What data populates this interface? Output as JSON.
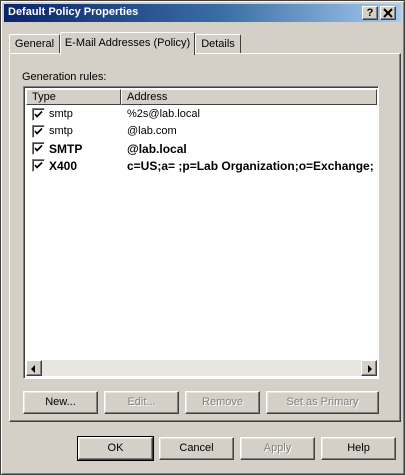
{
  "window": {
    "title": "Default Policy Properties"
  },
  "title_buttons": {
    "help": "?",
    "close": "X"
  },
  "tabs": [
    {
      "label": "General",
      "active": false
    },
    {
      "label": "E-Mail Addresses (Policy)",
      "active": true
    },
    {
      "label": "Details",
      "active": false
    }
  ],
  "generation_rules": {
    "label": "Generation rules:",
    "columns": {
      "type": "Type",
      "address": "Address"
    },
    "rows": [
      {
        "checked": true,
        "type": "smtp",
        "address": "%2s@lab.local",
        "bold": false
      },
      {
        "checked": true,
        "type": "smtp",
        "address": "@lab.com",
        "bold": false
      },
      {
        "checked": true,
        "type": "SMTP",
        "address": "@lab.local",
        "bold": true
      },
      {
        "checked": true,
        "type": "X400",
        "address": "c=US;a= ;p=Lab Organization;o=Exchange;",
        "bold": true
      }
    ]
  },
  "rule_buttons": {
    "new": "New...",
    "edit": "Edit...",
    "remove": "Remove",
    "set_primary": "Set as Primary"
  },
  "dialog_buttons": {
    "ok": "OK",
    "cancel": "Cancel",
    "apply": "Apply",
    "help": "Help"
  },
  "colors": {
    "title_gradient_start": "#0a246a",
    "title_gradient_end": "#a6caf0",
    "face": "#d4d0c8"
  }
}
